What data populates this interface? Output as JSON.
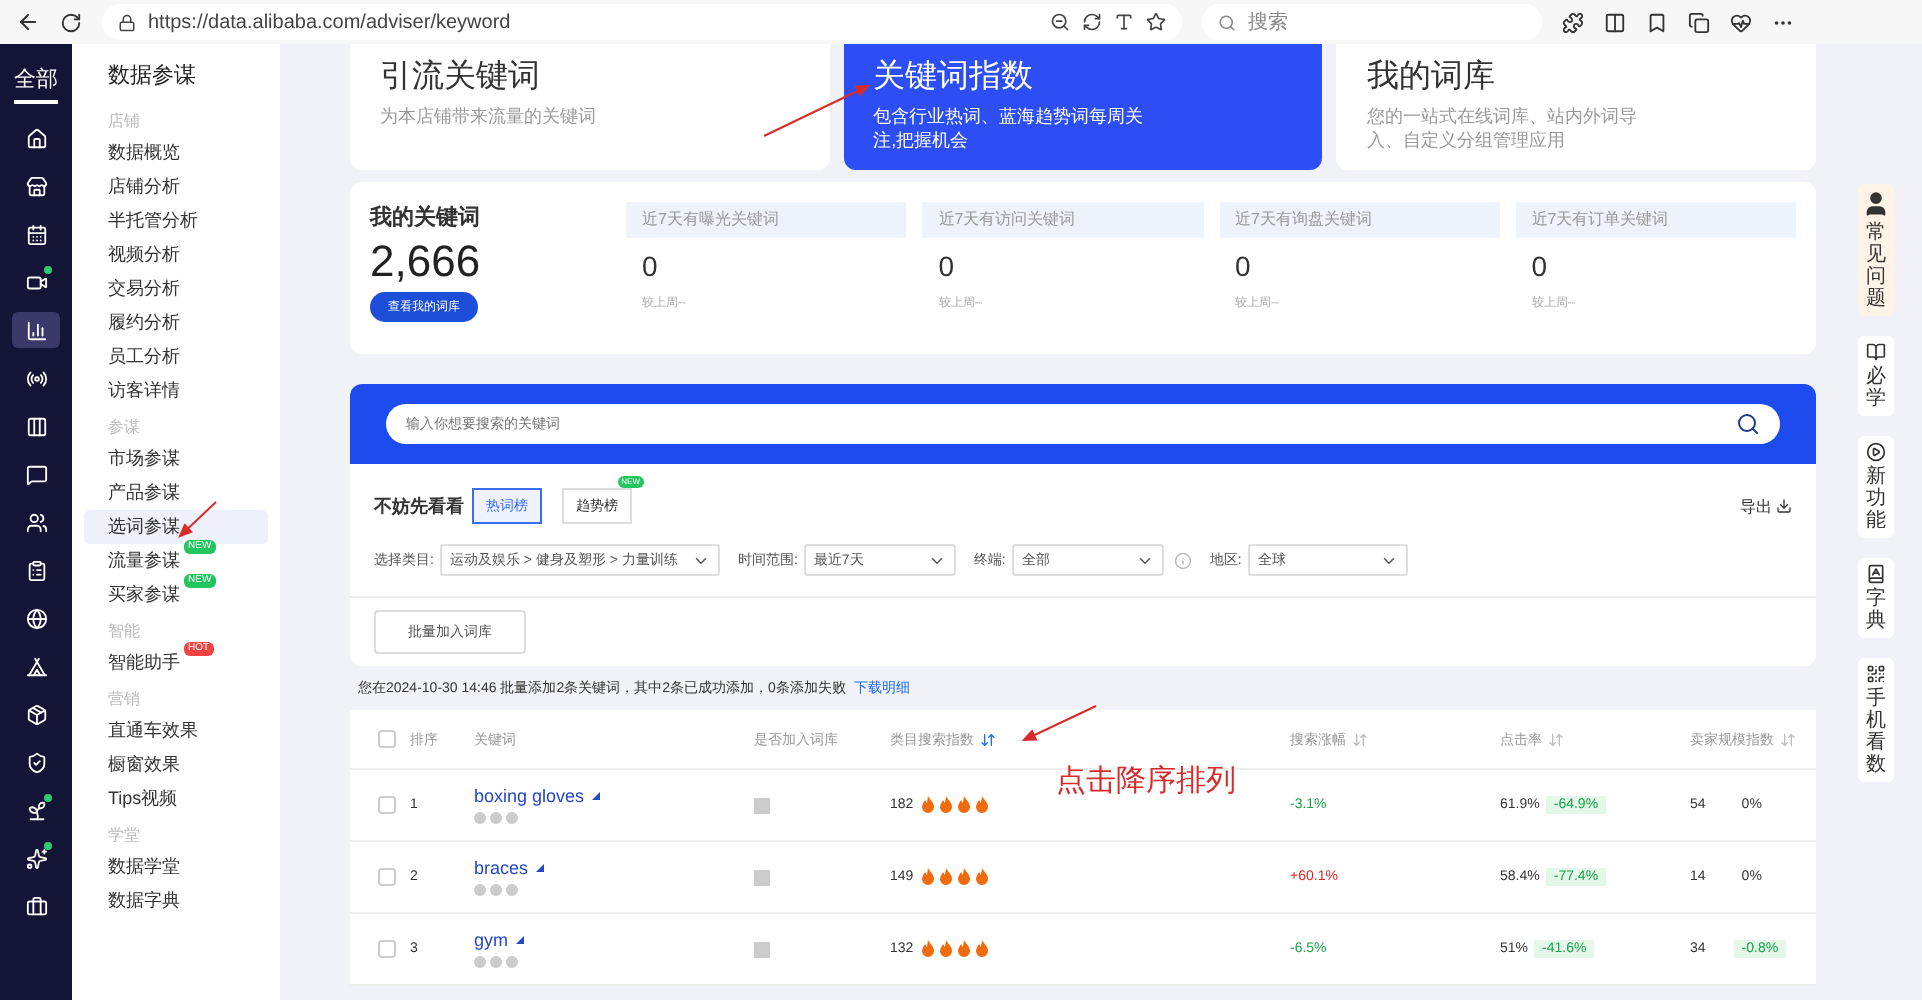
{
  "browser": {
    "url": "https://data.alibaba.com/adviser/keyword",
    "search_placeholder": "搜索"
  },
  "rail": {
    "label": "全部",
    "items": [
      {
        "dot": false,
        "selected": false
      },
      {
        "dot": false,
        "selected": false
      },
      {
        "dot": false,
        "selected": false
      },
      {
        "dot": true,
        "selected": false
      },
      {
        "dot": false,
        "selected": true
      },
      {
        "dot": false,
        "selected": false
      },
      {
        "dot": false,
        "selected": false
      },
      {
        "dot": false,
        "selected": false
      },
      {
        "dot": false,
        "selected": false
      },
      {
        "dot": false,
        "selected": false
      },
      {
        "dot": false,
        "selected": false
      },
      {
        "dot": false,
        "selected": false
      },
      {
        "dot": false,
        "selected": false
      },
      {
        "dot": false,
        "selected": false
      },
      {
        "dot": true,
        "selected": false
      },
      {
        "dot": true,
        "selected": false
      },
      {
        "dot": false,
        "selected": false
      }
    ]
  },
  "sidebar": {
    "title": "数据参谋",
    "sections": [
      {
        "heading": "店铺",
        "items": [
          {
            "label": "数据概览",
            "selected": false
          },
          {
            "label": "店铺分析",
            "selected": false
          },
          {
            "label": "半托管分析",
            "selected": false
          },
          {
            "label": "视频分析",
            "selected": false
          },
          {
            "label": "交易分析",
            "selected": false
          },
          {
            "label": "履约分析",
            "selected": false
          },
          {
            "label": "员工分析",
            "selected": false
          },
          {
            "label": "访客详情",
            "selected": false
          }
        ]
      },
      {
        "heading": "参谋",
        "items": [
          {
            "label": "市场参谋",
            "selected": false
          },
          {
            "label": "产品参谋",
            "selected": false
          },
          {
            "label": "选词参谋",
            "selected": true
          },
          {
            "label": "流量参谋",
            "selected": false,
            "badge": {
              "text": "NEW",
              "kind": "new"
            }
          },
          {
            "label": "买家参谋",
            "selected": false,
            "badge": {
              "text": "NEW",
              "kind": "new"
            }
          }
        ]
      },
      {
        "heading": "智能",
        "items": [
          {
            "label": "智能助手",
            "selected": false,
            "badge": {
              "text": "HOT",
              "kind": "hot"
            }
          }
        ]
      },
      {
        "heading": "营销",
        "items": [
          {
            "label": "直通车效果",
            "selected": false
          },
          {
            "label": "橱窗效果",
            "selected": false
          },
          {
            "label": "Tips视频",
            "selected": false
          }
        ]
      },
      {
        "heading": "学堂",
        "items": [
          {
            "label": "数据学堂",
            "selected": false
          },
          {
            "label": "数据字典",
            "selected": false
          }
        ]
      }
    ]
  },
  "feature_cards": [
    {
      "title": "引流关键词",
      "description": "为本店铺带来流量的关键词",
      "selected": false
    },
    {
      "title": "关键词指数",
      "description": "包含行业热词、蓝海趋势词每周关注,把握机会",
      "selected": true
    },
    {
      "title": "我的词库",
      "description": "您的一站式在线词库、站内外词导入、自定义分组管理应用",
      "selected": false
    }
  ],
  "my_keywords": {
    "title": "我的关键词",
    "count": "2,666",
    "button": "查看我的词库",
    "stats": [
      {
        "label": "近7天有曝光关键词",
        "value": "0",
        "note": "较上周--"
      },
      {
        "label": "近7天有访问关键词",
        "value": "0",
        "note": "较上周--"
      },
      {
        "label": "近7天有询盘关键词",
        "value": "0",
        "note": "较上周--"
      },
      {
        "label": "近7天有订单关键词",
        "value": "0",
        "note": "较上周--"
      }
    ]
  },
  "search": {
    "placeholder": "输入你想要搜索的关键词"
  },
  "ranking": {
    "title": "不妨先看看",
    "tabs": [
      {
        "label": "热词榜",
        "selected": true
      },
      {
        "label": "趋势榜",
        "selected": false,
        "badge": "NEW"
      }
    ],
    "export": "导出",
    "filters": [
      {
        "label": "选择类目:",
        "value": "运动及娱乐 > 健身及塑形 > 力量训练",
        "info": false
      },
      {
        "label": "时间范围:",
        "value": "最近7天",
        "info": false
      },
      {
        "label": "终端:",
        "value": "全部",
        "info": true
      },
      {
        "label": "地区:",
        "value": "全球",
        "info": false
      }
    ],
    "bulk_button": "批量加入词库"
  },
  "notice": {
    "text": "您在2024-10-30 14:46 批量添加2条关键词，其中2条已成功添加，0条添加失败",
    "link": "下载明细"
  },
  "table": {
    "header_checked": false,
    "columns": [
      {
        "label": "排序"
      },
      {
        "label": "关键词"
      },
      {
        "label": "是否加入词库"
      },
      {
        "label": "类目搜索指数",
        "sorted": true
      },
      {
        "label": "搜索涨幅",
        "sorted": false
      },
      {
        "label": "点击率",
        "sorted": false
      },
      {
        "label": "卖家规模指数",
        "sorted": false
      }
    ],
    "rows": [
      {
        "checked": false,
        "rank": "1",
        "keyword": "boxing gloves",
        "index": "182",
        "stars": 4,
        "growth": {
          "text": "-3.1%",
          "kind": "down"
        },
        "ctr": "61.9%",
        "ctr_change": {
          "text": "-64.9%",
          "kind": "down"
        },
        "seller": "54",
        "seller_change": {
          "text": "0%",
          "kind": "flat"
        }
      },
      {
        "checked": false,
        "rank": "2",
        "keyword": "braces",
        "index": "149",
        "stars": 4,
        "growth": {
          "text": "+60.1%",
          "kind": "up"
        },
        "ctr": "58.4%",
        "ctr_change": {
          "text": "-77.4%",
          "kind": "down"
        },
        "seller": "14",
        "seller_change": {
          "text": "0%",
          "kind": "flat"
        }
      },
      {
        "checked": false,
        "rank": "3",
        "keyword": "gym",
        "index": "132",
        "stars": 4,
        "growth": {
          "text": "-6.5%",
          "kind": "down"
        },
        "ctr": "51%",
        "ctr_change": {
          "text": "-41.6%",
          "kind": "down"
        },
        "seller": "34",
        "seller_change": {
          "text": "-0.8%",
          "kind": "down"
        }
      }
    ]
  },
  "help_panel": [
    {
      "label": "常见问题",
      "kind": "avatar"
    },
    {
      "label": "必学",
      "kind": "book"
    },
    {
      "label": "新功能",
      "kind": "play"
    },
    {
      "label": "字典",
      "kind": "dict"
    },
    {
      "label": "手机看数",
      "kind": "qr"
    }
  ],
  "annotation": {
    "text": "点击降序排列"
  }
}
